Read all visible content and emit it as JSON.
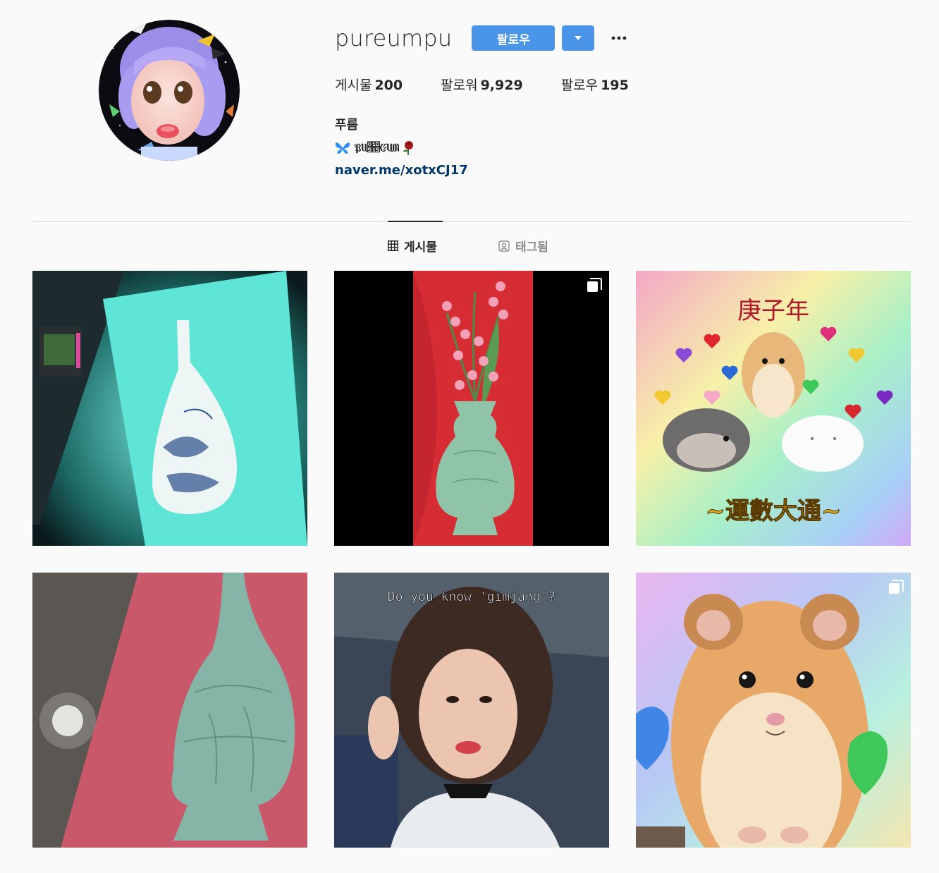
{
  "profile": {
    "username": "pureumpu",
    "follow_label": "팔로우",
    "stats": [
      {
        "label": "게시물",
        "value": "200"
      },
      {
        "label": "팔로워",
        "value": "9,929"
      },
      {
        "label": "팔로우",
        "value": "195"
      }
    ],
    "display_name": "푸름",
    "bio_line": "𝔓𝔘𝔕𝔈𝔘𝔐",
    "link": "naver.me/xotxCJ17"
  },
  "tabs": {
    "posts_label": "게시물",
    "tagged_label": "태그됨"
  },
  "posts": [
    {
      "kind": "celadon-vase-screen",
      "multi": false
    },
    {
      "kind": "lily-vase",
      "multi": true
    },
    {
      "kind": "hamsters",
      "caption_top": "庚子年",
      "caption_bottom": "~運數大通~",
      "multi": false
    },
    {
      "kind": "celadon-vase-photo",
      "multi": false
    },
    {
      "kind": "selfie",
      "caption_top": "Do you know 'gimjang'?",
      "multi": false
    },
    {
      "kind": "hamster-closeup",
      "multi": true
    }
  ],
  "colors": {
    "follow_blue": "#4a95e8",
    "link": "#00376b",
    "muted": "#8e8e8e"
  }
}
